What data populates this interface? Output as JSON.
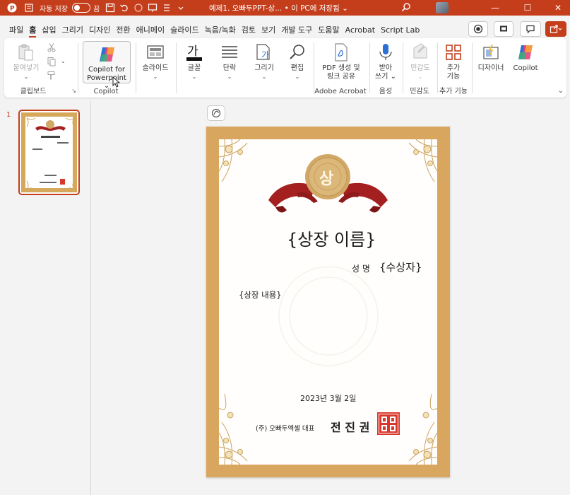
{
  "titlebar": {
    "autosave_label": "자동 저장",
    "autosave_state": "끔",
    "doc_title": "예제1. 오빠두PPT-상... • 이 PC에 저장됨 ⌄",
    "min_glyph": "—",
    "max_glyph": "☐",
    "close_glyph": "✕"
  },
  "tabs": [
    "파일",
    "홈",
    "삽입",
    "그리기",
    "디자인",
    "전환",
    "애니메이",
    "슬라이드",
    "녹음/녹화",
    "검토",
    "보기",
    "개발 도구",
    "도움말",
    "Acrobat",
    "Script Lab"
  ],
  "active_tab": "홈",
  "ribbon": {
    "paste_label": "붙여넣기",
    "clipboard_group": "클립보드",
    "copilot_line1": "Copilot for",
    "copilot_line2": "Powerpoint ⌄",
    "copilot_group": "Copilot",
    "slides_label": "슬라이드",
    "font_label": "글꼴",
    "paragraph_label": "단락",
    "drawing_label": "그리기",
    "editing_label": "편집",
    "pdf_line1": "PDF 생성 및",
    "pdf_line2": "링크 공유",
    "adobe_group": "Adobe Acrobat",
    "dictate_line1": "받아",
    "dictate_line2": "쓰기 ⌄",
    "voice_group": "음성",
    "sensitivity_label": "민감도",
    "sensitivity_group": "민감도",
    "addins_line1": "추가",
    "addins_line2": "기능",
    "addins_group": "추가 기능",
    "designer_label": "디자이너",
    "copilot_btn_label": "Copilot"
  },
  "thumbnails": {
    "slide_number": "1"
  },
  "certificate": {
    "seal_char": "상",
    "award_name": "{상장 이름}",
    "recipient_prefix": "성 명",
    "recipient": "{수상자}",
    "content": "{상장 내용}",
    "date": "2023년 3월 2일",
    "issuer_prefix": "(주) 오빠두엑셀 대표",
    "issuer_name": "전 진 권"
  },
  "colors": {
    "accent": "#c43e1c",
    "frame": "#d8a65e",
    "ribbon_red": "#a41f1f",
    "seal_gold": "#d2a867",
    "stamp_red": "#d8382c"
  },
  "icons": [
    "powerpoint-logo-icon",
    "save-icon",
    "undo-icon",
    "search-icon",
    "present-icon",
    "share-icon",
    "comment-icon",
    "copilot-icon",
    "paste-icon",
    "cut-icon",
    "copy-icon",
    "format-painter-icon",
    "new-slide-icon",
    "font-icon",
    "paragraph-icon",
    "shapes-icon",
    "find-icon",
    "pdf-icon",
    "microphone-icon",
    "sensitivity-icon",
    "addins-icon",
    "designer-icon",
    "expand-ribbon-icon"
  ]
}
